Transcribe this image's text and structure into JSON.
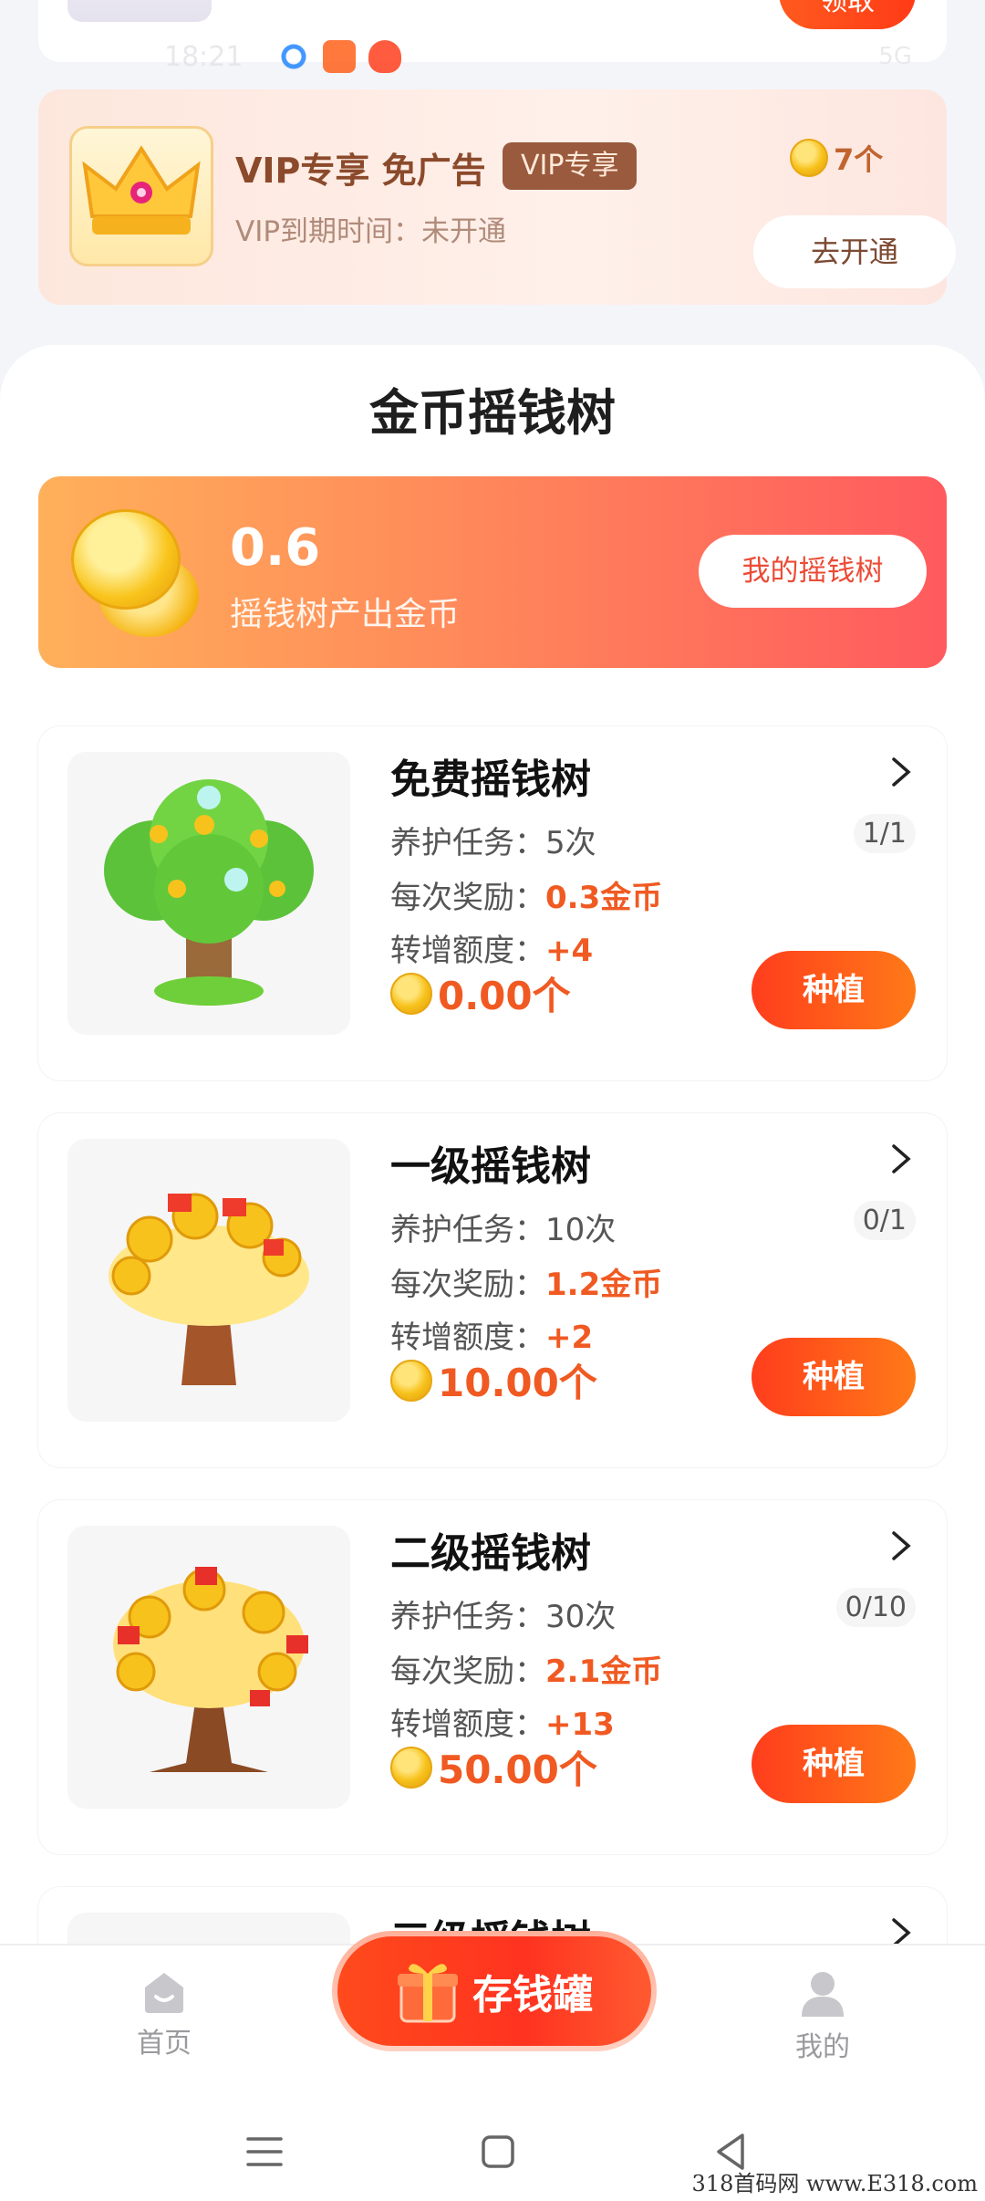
{
  "top_card": {
    "claim_label": "领取"
  },
  "status_ghost": {
    "time": "18:21",
    "right": "5G"
  },
  "vip": {
    "title": "VIP专享 免广告",
    "badge": "VIP专享",
    "expire": "VIP到期时间：未开通",
    "coin_count": "7个",
    "open_label": "去开通"
  },
  "section_title": "金币摇钱树",
  "banner": {
    "value": "0.6",
    "label": "摇钱树产出金币",
    "button_label": "我的摇钱树"
  },
  "trees": [
    {
      "name": "免费摇钱树",
      "task_label": "养护任务：",
      "task_value": "5次",
      "reward_label": "每次奖励：",
      "reward_value": "0.3金币",
      "transfer_label": "转增额度：",
      "transfer_value": "+4",
      "progress": "1/1",
      "price": "0.00个",
      "button": "种植"
    },
    {
      "name": "一级摇钱树",
      "task_label": "养护任务：",
      "task_value": "10次",
      "reward_label": "每次奖励：",
      "reward_value": "1.2金币",
      "transfer_label": "转增额度：",
      "transfer_value": "+2",
      "progress": "0/1",
      "price": "10.00个",
      "button": "种植"
    },
    {
      "name": "二级摇钱树",
      "task_label": "养护任务：",
      "task_value": "30次",
      "reward_label": "每次奖励：",
      "reward_value": "2.1金币",
      "transfer_label": "转增额度：",
      "transfer_value": "+13",
      "progress": "0/10",
      "price": "50.00个",
      "button": "种植"
    },
    {
      "name": "三级摇钱树"
    }
  ],
  "nav": {
    "home": "首页",
    "piggy": "存钱罐",
    "mine": "我的"
  },
  "watermark": "318首码网 www.E318.com",
  "colors": {
    "accent": "#ff3d1c",
    "highlight": "#f05a22",
    "vip_brown": "#8b4a2b"
  }
}
